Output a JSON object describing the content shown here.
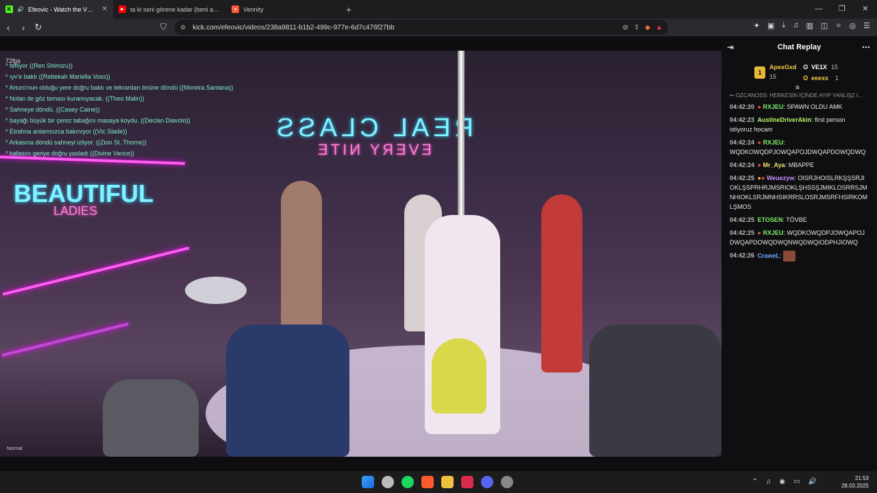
{
  "browser": {
    "tabs": [
      {
        "title": "Efeovic - Watch the VOD on K",
        "fav_color": "#53fc18",
        "fav_glyph": "K"
      },
      {
        "title": "ta ki seni görene kadar (beni al) - cov",
        "fav_color": "#ff0000",
        "fav_glyph": "▶"
      },
      {
        "title": "Vennity",
        "fav_color": "#ff5a3c",
        "fav_glyph": "●"
      }
    ],
    "url": "kick.com/efeovic/videos/238a9811-b1b2-499c-977e-6d7c476f27bb"
  },
  "video": {
    "fps": "72fps",
    "game_chat": [
      "* tefliyor ((Ren Shimizu))",
      "* ıyv'e baktı ((Rebekah Mariella Voss))",
      "* Arturo'nun olduğu yere doğru baktı ve tekrardan önüne döndü ((Moreira Santana))",
      "* Nolan ile göz teması kuramıyacak. ((Theo Malin))",
      "* Sahneye döndü. ((Casey Caine))",
      "* bayağı büyük bir çerez tabağını masaya koydu. ((Declan Diavolo))",
      "* Etrafına anlamsızca bakınıyor ((Vic Slade))",
      "* Arkasına döndü sahneyi izliyor. ((Zion St. Thorne))",
      "* kafasını geriye doğru yasladı ((Divine Vance))"
    ],
    "sign_beautiful": "BEAUTIFUL",
    "sign_ladies": "LADIES",
    "sign_real": "REAL CLASS",
    "sign_nite": "EVERY NITE",
    "quality": "Normal"
  },
  "chat": {
    "title": "Chat Replay",
    "leaderboard": [
      {
        "rank": "1",
        "name": "ApexGxd",
        "count": "15"
      },
      {
        "name": "VE1X",
        "count": "15"
      },
      {
        "name": "eeexs",
        "count": "1"
      }
    ],
    "pinned": "↩ OZCANOSS: HERKESİN İÇİNDE AYIP YANLIŞZ I...",
    "messages": [
      {
        "ts": "04:42:20",
        "user": "RXJEU",
        "color": "#7ef06a",
        "text": "SPAWN OLDU AMK"
      },
      {
        "ts": "04:42:23",
        "user": "AustineDriverAkin",
        "color": "#b7f56a",
        "text": "first person istiyoruz hocam"
      },
      {
        "ts": "04:42:24",
        "user": "RXJEU",
        "color": "#7ef06a",
        "text": "WQDKOWQDPJOWQAPOJDWQAPDOWQDWQ"
      },
      {
        "ts": "04:42:24",
        "user": "Mr_Aya",
        "color": "#f0e06a",
        "text": "MBAPPE"
      },
      {
        "ts": "04:42:25",
        "user": "Weuezyw",
        "color": "#c78cff",
        "text": "OISRJHOISLRKŞŞSRJIOKLŞSPRHRJMSRIOKLŞHSSŞJMIKLOSRRSJMNHIOKLSRJMNHSIKRRSLOSRJMSRFHSIRKOMLŞMOS"
      },
      {
        "ts": "04:42:25",
        "user": "ETOSEN",
        "color": "#7ef06a",
        "text": "TÖVBE"
      },
      {
        "ts": "04:42:25",
        "user": "RXJEU",
        "color": "#7ef06a",
        "text": "WQDKOWQDPJOWQAPOJDWQAPDOWQDWQNWQDWQIODPHJIOWQ"
      },
      {
        "ts": "04:42:26",
        "user": "CraweL",
        "color": "#6aa8ff",
        "text": ""
      }
    ]
  },
  "taskbar": {
    "time": "21:53",
    "date": "28.03.2025"
  }
}
